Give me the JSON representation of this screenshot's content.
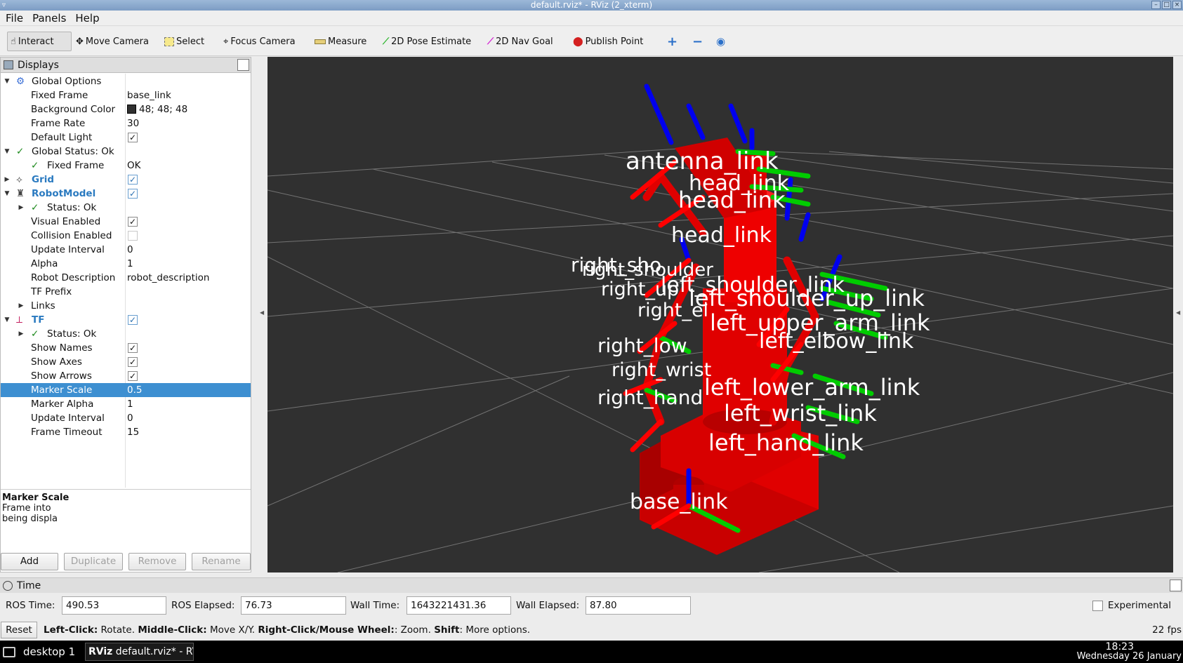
{
  "window": {
    "title": "default.rviz* - RViz (2_xterm)"
  },
  "menu": [
    "File",
    "Panels",
    "Help"
  ],
  "toolbar": {
    "interact": "Interact",
    "move_camera": "Move Camera",
    "select": "Select",
    "focus_camera": "Focus Camera",
    "measure": "Measure",
    "pose_estimate": "2D Pose Estimate",
    "nav_goal": "2D Nav Goal",
    "publish_point": "Publish Point"
  },
  "displays": {
    "title": "Displays",
    "rows": [
      {
        "name": "Global Options",
        "value": ""
      },
      {
        "name": "Fixed Frame",
        "value": "base_link"
      },
      {
        "name": "Background Color",
        "value": "48; 48; 48"
      },
      {
        "name": "Frame Rate",
        "value": "30"
      },
      {
        "name": "Default Light",
        "value": ""
      },
      {
        "name": "Global Status: Ok",
        "value": ""
      },
      {
        "name": "Fixed Frame",
        "value": "OK"
      },
      {
        "name": "Grid",
        "value": ""
      },
      {
        "name": "RobotModel",
        "value": ""
      },
      {
        "name": "Status: Ok",
        "value": ""
      },
      {
        "name": "Visual Enabled",
        "value": ""
      },
      {
        "name": "Collision Enabled",
        "value": ""
      },
      {
        "name": "Update Interval",
        "value": "0"
      },
      {
        "name": "Alpha",
        "value": "1"
      },
      {
        "name": "Robot Description",
        "value": "robot_description"
      },
      {
        "name": "TF Prefix",
        "value": ""
      },
      {
        "name": "Links",
        "value": ""
      },
      {
        "name": "TF",
        "value": ""
      },
      {
        "name": "Status: Ok",
        "value": ""
      },
      {
        "name": "Show Names",
        "value": ""
      },
      {
        "name": "Show Axes",
        "value": ""
      },
      {
        "name": "Show Arrows",
        "value": ""
      },
      {
        "name": "Marker Scale",
        "value": "0.5"
      },
      {
        "name": "Marker Alpha",
        "value": "1"
      },
      {
        "name": "Update Interval",
        "value": "0"
      },
      {
        "name": "Frame Timeout",
        "value": "15"
      }
    ],
    "description": {
      "title": "Marker Scale",
      "line1": "Frame into  ",
      "line2": "being displa"
    },
    "buttons": {
      "add": "Add",
      "duplicate": "Duplicate",
      "remove": "Remove",
      "rename": "Rename"
    }
  },
  "viewport": {
    "background": "#303030",
    "labels": [
      "antenna_link",
      "head_link",
      "head_link",
      "head_link",
      "right_sho",
      "right_shoulder",
      "right_up",
      "right_el",
      "left_shoulder_link",
      "left_shoulder_up_link",
      "left_upper_arm_link",
      "left_elbow_link",
      "right_low",
      "right_wrist",
      "right_hand",
      "left_lower_arm_link",
      "left_wrist_link",
      "left_hand_link",
      "base_link"
    ]
  },
  "time": {
    "title": "Time",
    "ros_time_label": "ROS Time:",
    "ros_time": "490.53",
    "ros_elapsed_label": "ROS Elapsed:",
    "ros_elapsed": "76.73",
    "wall_time_label": "Wall Time:",
    "wall_time": "1643221431.36",
    "wall_elapsed_label": "Wall Elapsed:",
    "wall_elapsed": "87.80",
    "experimental": "Experimental"
  },
  "status": {
    "reset": "Reset",
    "left_click": "Left-Click:",
    "left_click_action": "Rotate.",
    "middle_click": "Middle-Click:",
    "middle_click_action": "Move X/Y.",
    "right_click": "Right-Click/Mouse Wheel:",
    "right_click_action": ": Zoom.",
    "shift": "Shift",
    "shift_action": ": More options.",
    "fps": "22 fps"
  },
  "taskbar": {
    "desktop": "desktop 1",
    "task": "default.rviz* - RV...",
    "time": "18:23",
    "date": "Wednesday 26 January"
  },
  "colors": {
    "robot": "#dd0000",
    "axis_x": "#ff0000",
    "axis_y": "#00cc00",
    "axis_z": "#0000ee",
    "selection": "#3d8fd1"
  }
}
